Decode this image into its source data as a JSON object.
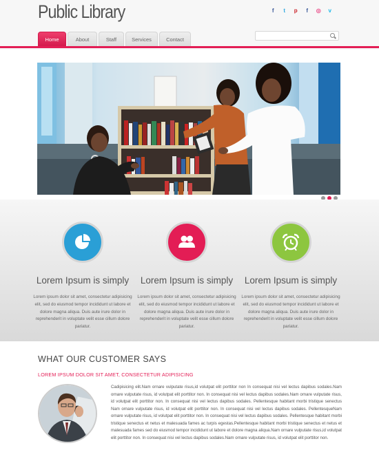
{
  "header": {
    "logo": "Public Library"
  },
  "social": [
    {
      "icon": "facebook-icon",
      "glyph": "f",
      "color": "#3b5998"
    },
    {
      "icon": "twitter-icon",
      "glyph": "t",
      "color": "#2fa9e0"
    },
    {
      "icon": "pinterest-icon",
      "glyph": "p",
      "color": "#cb2027"
    },
    {
      "icon": "facebook-alt-icon",
      "glyph": "f",
      "color": "#3b5998"
    },
    {
      "icon": "dribbble-icon",
      "glyph": "◎",
      "color": "#ea4c89"
    },
    {
      "icon": "vimeo-icon",
      "glyph": "v",
      "color": "#1ab7ea"
    }
  ],
  "nav": [
    {
      "label": "Home",
      "active": true
    },
    {
      "label": "About",
      "active": false
    },
    {
      "label": "Staff",
      "active": false
    },
    {
      "label": "Services",
      "active": false
    },
    {
      "label": "Contact",
      "active": false
    }
  ],
  "search": {
    "value": "",
    "placeholder": ""
  },
  "slider": {
    "active_index": 1,
    "count": 3
  },
  "features": [
    {
      "icon": "pie-chart-icon",
      "color": "#2a9fd6",
      "title": "Lorem Ipsum is simply",
      "text": "Lorem ipsum dolor sit amet, consectetur adipisicing elit, sed do eiusmod tempor incididunt ut labore et dolore magna aliqua. Duis aute irure dolor in reprehenderit in voluptate velit esse cillum dolore pariatur."
    },
    {
      "icon": "users-icon",
      "color": "#e31d55",
      "title": "Lorem Ipsum is simply",
      "text": "Lorem ipsum dolor sit amet, consectetur adipisicing elit, sed do eiusmod tempor incididunt ut labore et dolore magna aliqua. Duis aute irure dolor in reprehenderit in voluptate velit esse cillum dolore pariatur."
    },
    {
      "icon": "alarm-clock-icon",
      "color": "#8dc63f",
      "title": "Lorem Ipsum is simply",
      "text": "Lorem ipsum dolor sit amet, consectetur adipisicing elit, sed do eiusmod tempor incididunt ut labore et dolore magna aliqua. Duis aute irure dolor in reprehenderit in voluptate velit esse cillum dolore pariatur."
    }
  ],
  "testimonial": {
    "title": "WHAT OUR CUSTOMER SAYS",
    "subtitle": "LOREM IPSUM DOLOR SIT AMET, CONSECTETUR ADIPISICING",
    "text": "Cadipisicing elit.Nam ornare vulputate risus,id volutpat elit porttitor non In consequat nisi vel lectus dapibus sodales.Nam ornare vulputate risus, id volutpat elit porttitor non. In consequat nisi vel lectus dapibus sodales.Nam ornare vulputate risus, id volutpat elit porttitor non. In consequat nisi vel lectus dapibus sodales. Pellentesque habitant morbi tristique senectus Nam ornare vulputate risus, id volutpat elit porttitor non. In consequat nisi vel lectus dapibus sodales. PellentesqueNam ornare vulputate risus, id volutpat elit porttitor non. In consequat nisi vel lectus dapibus sodales. Pellentesque habitant morbi tristique senectus et netus et malesuada fames ac turpis egestas.Pellentesque habitant morbi tristique senectus et netus et malesuada fames sed do eiusmod tempor incididunt ut labore et dolore magna aliqua.Nam ornare vulputate risus,id volutpat elit porttitor non. In consequat nisi vel lectus dapibus sodales.Nam ornare vulputate risus, id volutpat elit porttitor non."
  },
  "colors": {
    "accent": "#e31d55",
    "blue": "#2a9fd6",
    "green": "#8dc63f"
  }
}
